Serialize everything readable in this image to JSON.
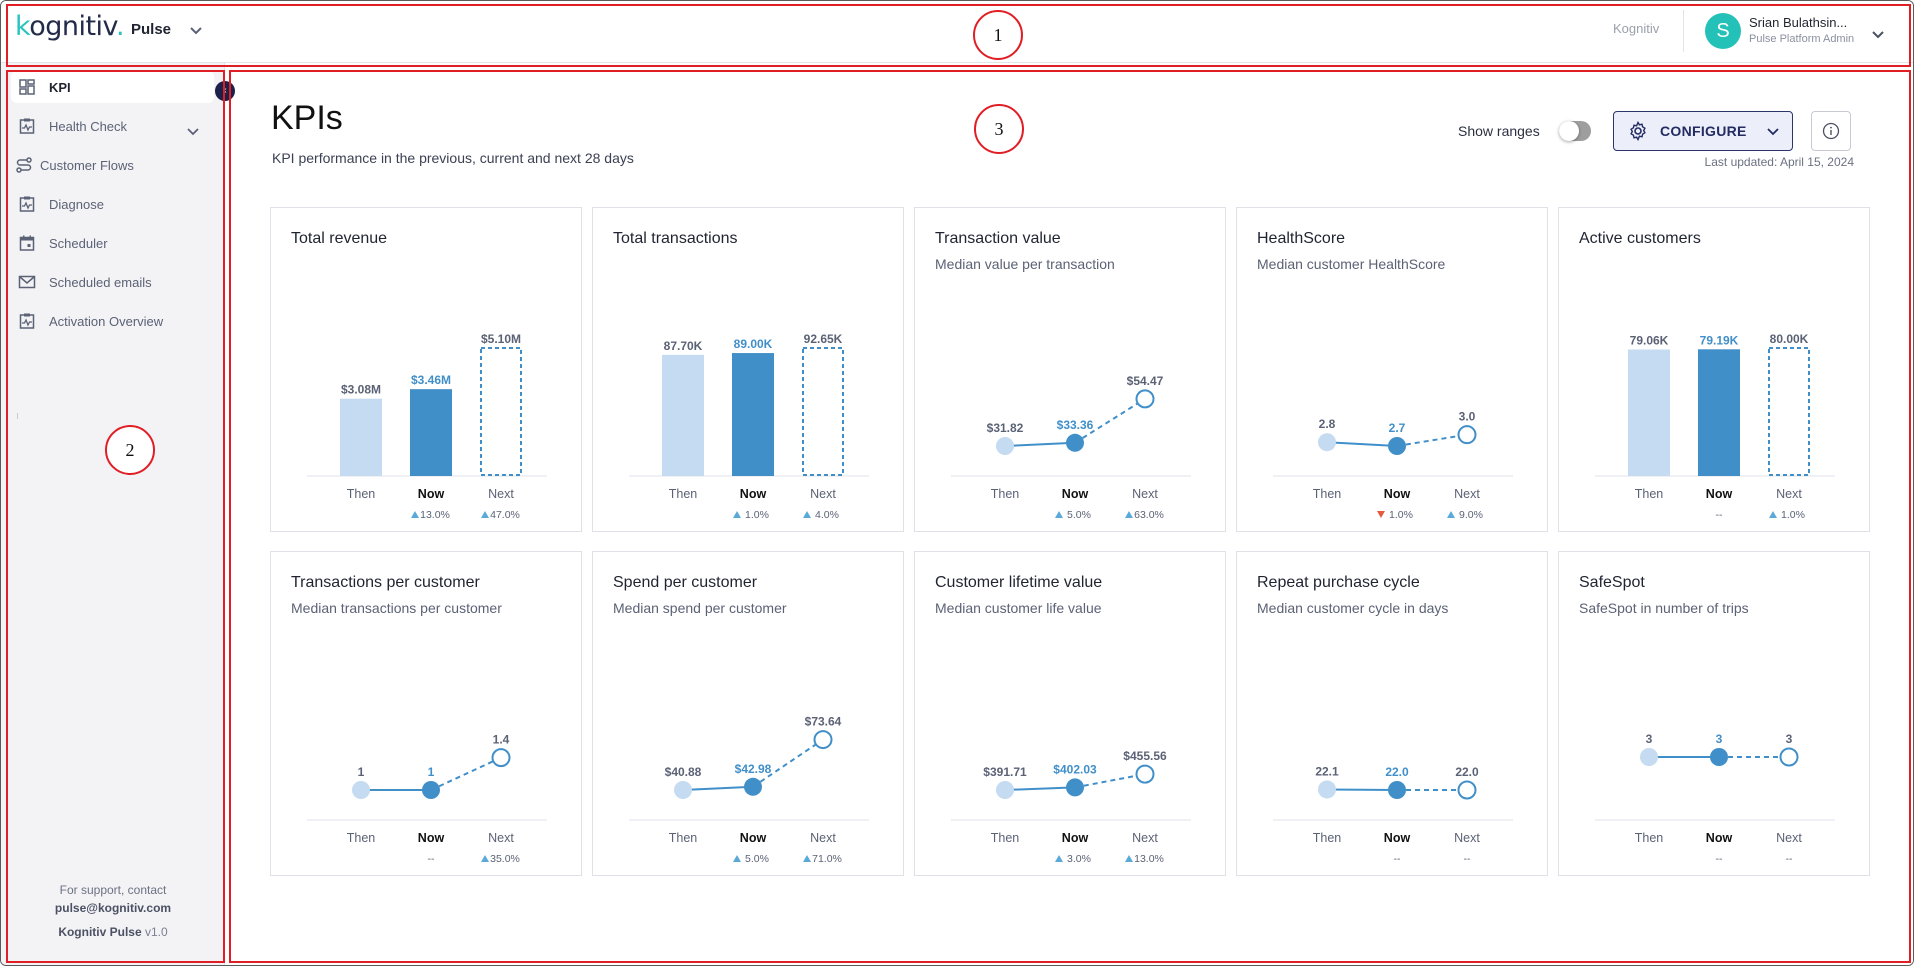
{
  "header": {
    "logo": "kognitiv",
    "app_name": "Pulse",
    "org_name": "Kognitiv",
    "user": {
      "initial": "S",
      "name": "Srian Bulathsin...",
      "role": "Pulse Platform Admin"
    }
  },
  "sidebar": {
    "items": [
      {
        "label": "KPI",
        "icon": "dashboard-grid-icon",
        "active": true
      },
      {
        "label": "Health Check",
        "icon": "clipboard-pulse-icon",
        "expandable": true
      },
      {
        "label": "Customer Flows",
        "icon": "route-icon"
      },
      {
        "label": "Diagnose",
        "icon": "clipboard-pulse-icon"
      },
      {
        "label": "Scheduler",
        "icon": "calendar-icon"
      },
      {
        "label": "Scheduled emails",
        "icon": "mail-icon"
      },
      {
        "label": "Activation Overview",
        "icon": "clipboard-pulse-icon"
      }
    ],
    "support_text": "For support, contact",
    "support_email": "pulse@kognitiv.com",
    "product_name": "Kognitiv Pulse",
    "version": "v1.0"
  },
  "main": {
    "title": "KPIs",
    "subtitle": "KPI performance in the previous, current and next 28 days",
    "show_ranges_label": "Show ranges",
    "show_ranges_on": false,
    "configure_label": "CONFIGURE",
    "last_updated": "Last updated: April 15, 2024"
  },
  "colors": {
    "then": "#c5dbf1",
    "now": "#418fc9",
    "next_stroke": "#418fc9",
    "label_gray": "#5b6275",
    "up_arrow": "#5aa9d9",
    "down_arrow": "#e65a3c",
    "accent_navy": "#232b63",
    "avatar_teal": "#23c1b8"
  },
  "annotations": [
    "1",
    "2",
    "3"
  ],
  "chart_data": [
    {
      "type": "bar",
      "title": "Total revenue",
      "subtitle": "",
      "categories": [
        "Then",
        "Now",
        "Next"
      ],
      "values": [
        3.08,
        3.46,
        5.1
      ],
      "unit": "M$",
      "labels": [
        "$3.08M",
        "$3.46M",
        "$5.10M"
      ],
      "changes": [
        null,
        {
          "dir": "up",
          "text": "13.0%"
        },
        {
          "dir": "up",
          "text": "47.0%"
        }
      ]
    },
    {
      "type": "bar",
      "title": "Total transactions",
      "subtitle": "",
      "categories": [
        "Then",
        "Now",
        "Next"
      ],
      "values": [
        87.7,
        89.0,
        92.65
      ],
      "unit": "K",
      "labels": [
        "87.70K",
        "89.00K",
        "92.65K"
      ],
      "changes": [
        null,
        {
          "dir": "up",
          "text": "1.0%"
        },
        {
          "dir": "up",
          "text": "4.0%"
        }
      ]
    },
    {
      "type": "line",
      "title": "Transaction value",
      "subtitle": "Median value per transaction",
      "categories": [
        "Then",
        "Now",
        "Next"
      ],
      "values": [
        31.82,
        33.36,
        54.47
      ],
      "labels": [
        "$31.82",
        "$33.36",
        "$54.47"
      ],
      "changes": [
        null,
        {
          "dir": "up",
          "text": "5.0%"
        },
        {
          "dir": "up",
          "text": "63.0%"
        }
      ]
    },
    {
      "type": "line",
      "title": "HealthScore",
      "subtitle": "Median customer HealthScore",
      "categories": [
        "Then",
        "Now",
        "Next"
      ],
      "values": [
        2.8,
        2.7,
        3.0
      ],
      "labels": [
        "2.8",
        "2.7",
        "3.0"
      ],
      "changes": [
        null,
        {
          "dir": "down",
          "text": "1.0%"
        },
        {
          "dir": "up",
          "text": "9.0%"
        }
      ]
    },
    {
      "type": "bar",
      "title": "Active customers",
      "subtitle": "",
      "categories": [
        "Then",
        "Now",
        "Next"
      ],
      "values": [
        79.06,
        79.19,
        80.0
      ],
      "unit": "K",
      "labels": [
        "79.06K",
        "79.19K",
        "80.00K"
      ],
      "changes": [
        null,
        {
          "dir": "none",
          "text": "--"
        },
        {
          "dir": "up",
          "text": "1.0%"
        }
      ]
    },
    {
      "type": "line",
      "title": "Transactions per customer",
      "subtitle": "Median transactions per customer",
      "categories": [
        "Then",
        "Now",
        "Next"
      ],
      "values": [
        1,
        1,
        1.4
      ],
      "labels": [
        "1",
        "1",
        "1.4"
      ],
      "changes": [
        null,
        {
          "dir": "none",
          "text": "--"
        },
        {
          "dir": "up",
          "text": "35.0%"
        }
      ]
    },
    {
      "type": "line",
      "title": "Spend per customer",
      "subtitle": "Median spend per customer",
      "categories": [
        "Then",
        "Now",
        "Next"
      ],
      "values": [
        40.88,
        42.98,
        73.64
      ],
      "labels": [
        "$40.88",
        "$42.98",
        "$73.64"
      ],
      "changes": [
        null,
        {
          "dir": "up",
          "text": "5.0%"
        },
        {
          "dir": "up",
          "text": "71.0%"
        }
      ]
    },
    {
      "type": "line",
      "title": "Customer lifetime value",
      "subtitle": "Median customer life value",
      "categories": [
        "Then",
        "Now",
        "Next"
      ],
      "values": [
        391.71,
        402.03,
        455.56
      ],
      "labels": [
        "$391.71",
        "$402.03",
        "$455.56"
      ],
      "changes": [
        null,
        {
          "dir": "up",
          "text": "3.0%"
        },
        {
          "dir": "up",
          "text": "13.0%"
        }
      ]
    },
    {
      "type": "line",
      "title": "Repeat purchase cycle",
      "subtitle": "Median customer cycle in days",
      "categories": [
        "Then",
        "Now",
        "Next"
      ],
      "values": [
        22.1,
        22.0,
        22.0
      ],
      "labels": [
        "22.1",
        "22.0",
        "22.0"
      ],
      "changes": [
        null,
        {
          "dir": "none",
          "text": "--"
        },
        {
          "dir": "none",
          "text": "--"
        }
      ]
    },
    {
      "type": "line",
      "title": "SafeSpot",
      "subtitle": "SafeSpot in number of trips",
      "categories": [
        "Then",
        "Now",
        "Next"
      ],
      "values": [
        3,
        3,
        3
      ],
      "labels": [
        "3",
        "3",
        "3"
      ],
      "changes": [
        null,
        {
          "dir": "none",
          "text": "--"
        },
        {
          "dir": "none",
          "text": "--"
        }
      ]
    }
  ]
}
